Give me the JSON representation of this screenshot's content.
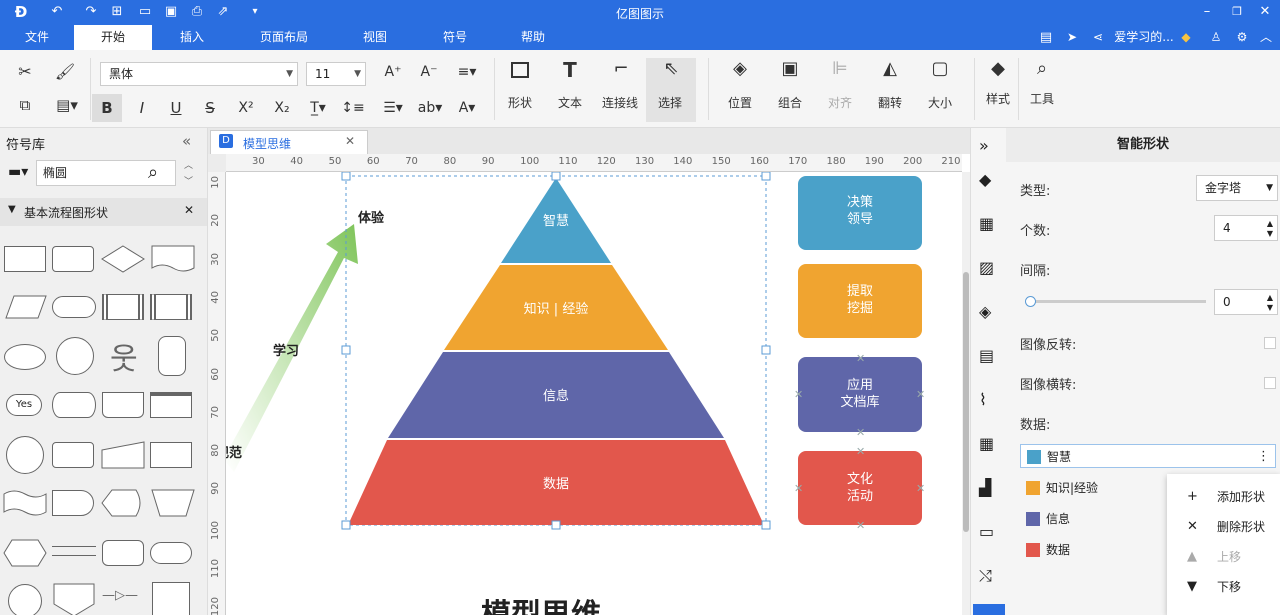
{
  "app": {
    "title": "亿图图示"
  },
  "menu": {
    "file": "文件",
    "start": "开始",
    "insert": "插入",
    "page_layout": "页面布局",
    "view": "视图",
    "symbol": "符号",
    "help": "帮助",
    "user": "爱学习的..."
  },
  "ribbon": {
    "font_name": "黑体",
    "font_size": "11",
    "shape": "形状",
    "text": "文本",
    "connector": "连接线",
    "select": "选择",
    "position": "位置",
    "group": "组合",
    "align": "对齐",
    "rotate": "翻转",
    "size": "大小",
    "style": "样式",
    "tools": "工具",
    "bold": "B",
    "italic": "I",
    "underline": "U",
    "strike": "S",
    "superscript": "X²",
    "subscript": "X₂"
  },
  "left_panel": {
    "title": "符号库",
    "search_value": "椭圆",
    "category": "基本流程图形状",
    "yes_label": "Yes"
  },
  "document_tab": {
    "label": "模型思维"
  },
  "ruler": {
    "top": [
      "30",
      "40",
      "50",
      "60",
      "70",
      "80",
      "90",
      "100",
      "110",
      "120",
      "130",
      "140",
      "150",
      "160",
      "170",
      "180",
      "190",
      "200",
      "210"
    ],
    "left": [
      "10",
      "20",
      "30",
      "40",
      "50",
      "60",
      "70",
      "80",
      "90",
      "100",
      "110",
      "120"
    ]
  },
  "diagram": {
    "pyramid": [
      {
        "label": "智慧",
        "color": "#4aa1c9"
      },
      {
        "label": "知识 | 经验",
        "color": "#f0a430"
      },
      {
        "label": "信息",
        "color": "#5f66a9"
      },
      {
        "label": "数据",
        "color": "#e2574c"
      }
    ],
    "boxes": [
      {
        "line1": "决策",
        "line2": "领导",
        "color": "#4aa1c9"
      },
      {
        "line1": "提取",
        "line2": "挖掘",
        "color": "#f0a430"
      },
      {
        "line1": "应用",
        "line2": "文档库",
        "color": "#5f66a9"
      },
      {
        "line1": "文化",
        "line2": "活动",
        "color": "#e2574c"
      }
    ],
    "label_experience": "体验",
    "label_learning": "学习",
    "label_norm": "规范",
    "bottom_title": "模型思维"
  },
  "right_panel": {
    "title": "智能形状",
    "type_label": "类型:",
    "type_value": "金字塔",
    "count_label": "个数:",
    "count_value": "4",
    "spacing_label": "间隔:",
    "spacing_value": "0",
    "flip_v_label": "图像反转:",
    "flip_h_label": "图像横转:",
    "data_label": "数据:",
    "data_items": [
      {
        "label": "智慧",
        "color": "#4aa1c9"
      },
      {
        "label": "知识|经验",
        "color": "#f0a430"
      },
      {
        "label": "信息",
        "color": "#5f66a9"
      },
      {
        "label": "数据",
        "color": "#e2574c"
      }
    ],
    "context_menu": {
      "add": "添加形状",
      "delete": "删除形状",
      "up": "上移",
      "down": "下移"
    }
  },
  "colors": {
    "accent": "#2a6ee0"
  }
}
